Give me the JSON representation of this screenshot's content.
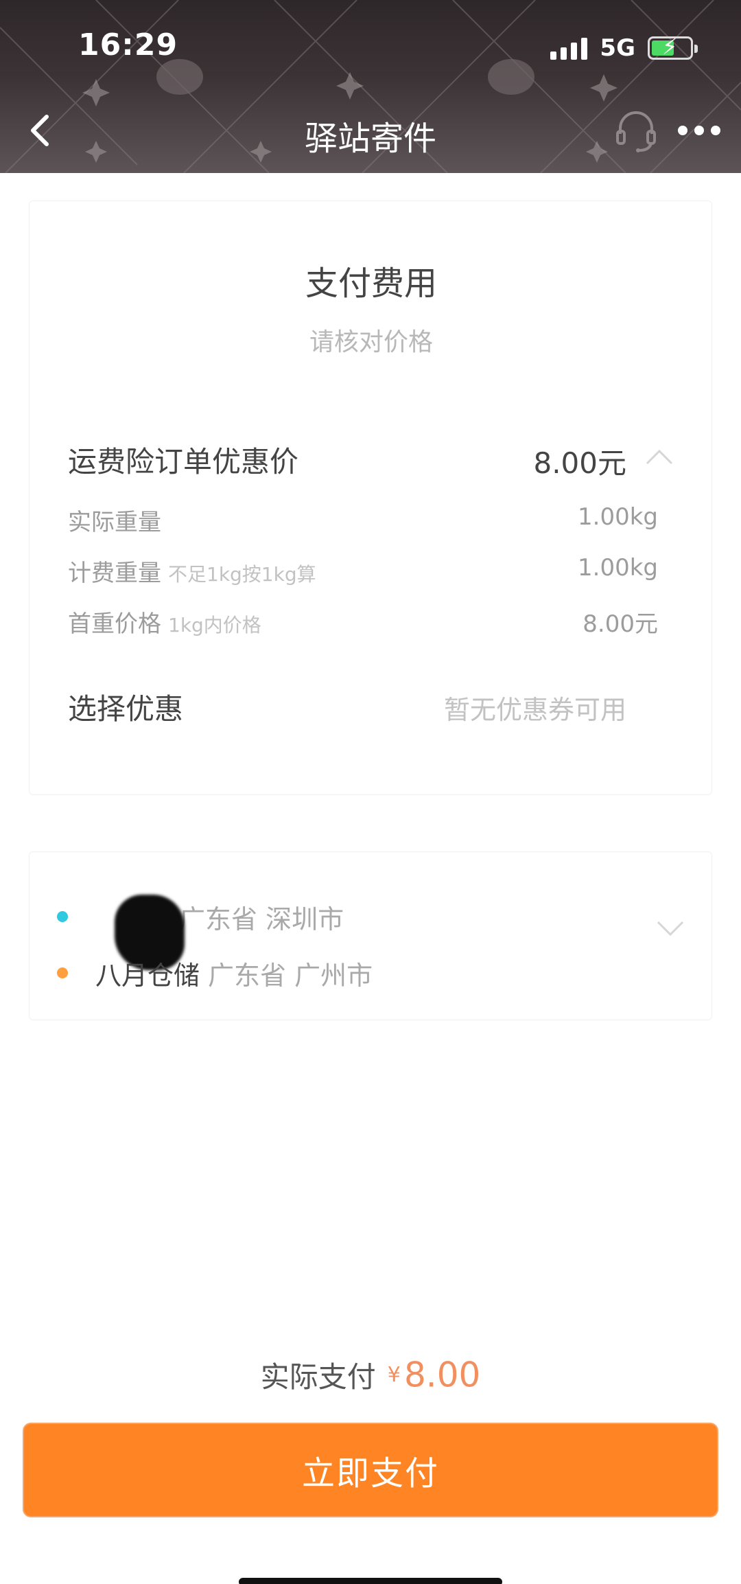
{
  "status_bar": {
    "time": "16:29",
    "network": "5G",
    "icons": [
      "signal-icon",
      "battery-charging-icon"
    ]
  },
  "header": {
    "title": "驿站寄件",
    "icons": [
      "back-arrow-icon",
      "customer-service-icon",
      "more-icon"
    ]
  },
  "fee_card": {
    "title": "支付费用",
    "subtitle": "请核对价格",
    "main_row": {
      "label": "运费险订单优惠价",
      "value": "8.00元"
    },
    "details": [
      {
        "label": "实际重量",
        "note": "",
        "value": "1.00kg"
      },
      {
        "label": "计费重量",
        "note": "不足1kg按1kg算",
        "value": "1.00kg"
      },
      {
        "label": "首重价格",
        "note": "1kg内价格",
        "value": "8.00元"
      }
    ],
    "coupon": {
      "label": "选择优惠",
      "value": "暂无优惠券可用"
    }
  },
  "route": {
    "sender": {
      "name": "",
      "address": "广东省 深圳市"
    },
    "receiver": {
      "name": "八月仓储",
      "address": "广东省 广州市"
    }
  },
  "payment": {
    "label": "实际支付",
    "currency": "¥",
    "amount": "8.00",
    "button_label": "立即支付"
  },
  "colors": {
    "accent": "#ff8424",
    "price": "#f28f5f",
    "sender_dot": "#2fc9e0",
    "receiver_dot": "#ff9f40"
  }
}
